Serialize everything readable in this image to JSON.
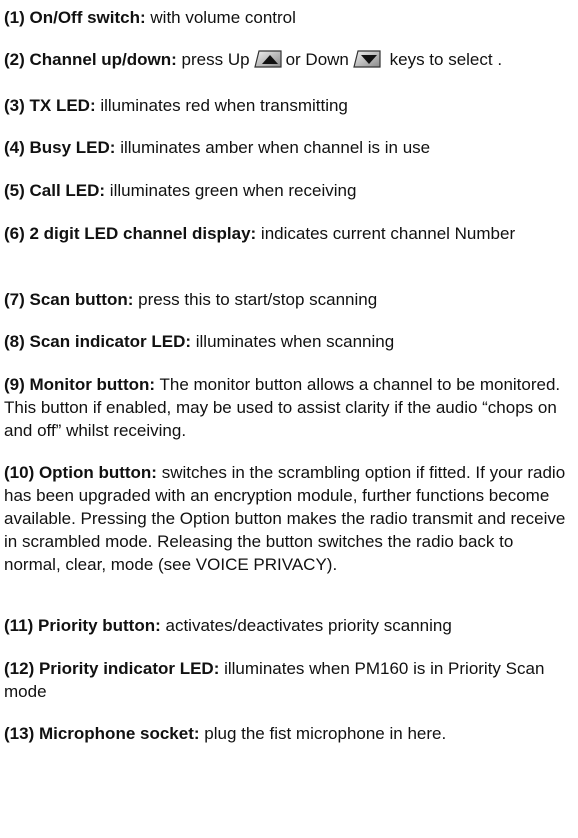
{
  "items": [
    {
      "label": "(1) On/Off switch:",
      "text": " with volume control"
    },
    {
      "label": "(2) Channel up/down:",
      "text_a": " press Up",
      "text_b": "or Down",
      "text_c": " keys to select .",
      "up_key_icon": "up-arrow-key-icon",
      "down_key_icon": "down-arrow-key-icon"
    },
    {
      "label": "(3) TX LED:",
      "text": " illuminates red when transmitting"
    },
    {
      "label": "(4) Busy LED:",
      "text": " illuminates amber when channel is in use"
    },
    {
      "label": "(5) Call LED:",
      "text": " illuminates green when receiving"
    },
    {
      "label": "(6) 2 digit LED channel display:",
      "text": " indicates current channel Number"
    },
    {
      "label": "(7) Scan button:",
      "text": " press this to start/stop scanning"
    },
    {
      "label": "(8) Scan indicator LED:",
      "text": " illuminates when scanning"
    },
    {
      "label": "(9) Monitor button:",
      "text": " The monitor button allows a channel to be monitored. This button if enabled, may be used to assist clarity if the audio “chops on and off” whilst receiving."
    },
    {
      "label": "(10) Option button:",
      "text": " switches in the scrambling option if fitted. If your radio has been upgraded with an encryption module, further functions become available. Pressing the Option button makes the radio transmit and receive in scrambled mode. Releasing the button switches the radio back to normal, clear, mode (see VOICE PRIVACY)."
    },
    {
      "label": "(11) Priority button:",
      "text": " activates/deactivates priority scanning"
    },
    {
      "label": "(12) Priority indicator LED:",
      "text": " illuminates when PM160 is in Priority Scan mode"
    },
    {
      "label": "(13) Microphone socket:",
      "text": " plug the fist microphone in here."
    }
  ]
}
